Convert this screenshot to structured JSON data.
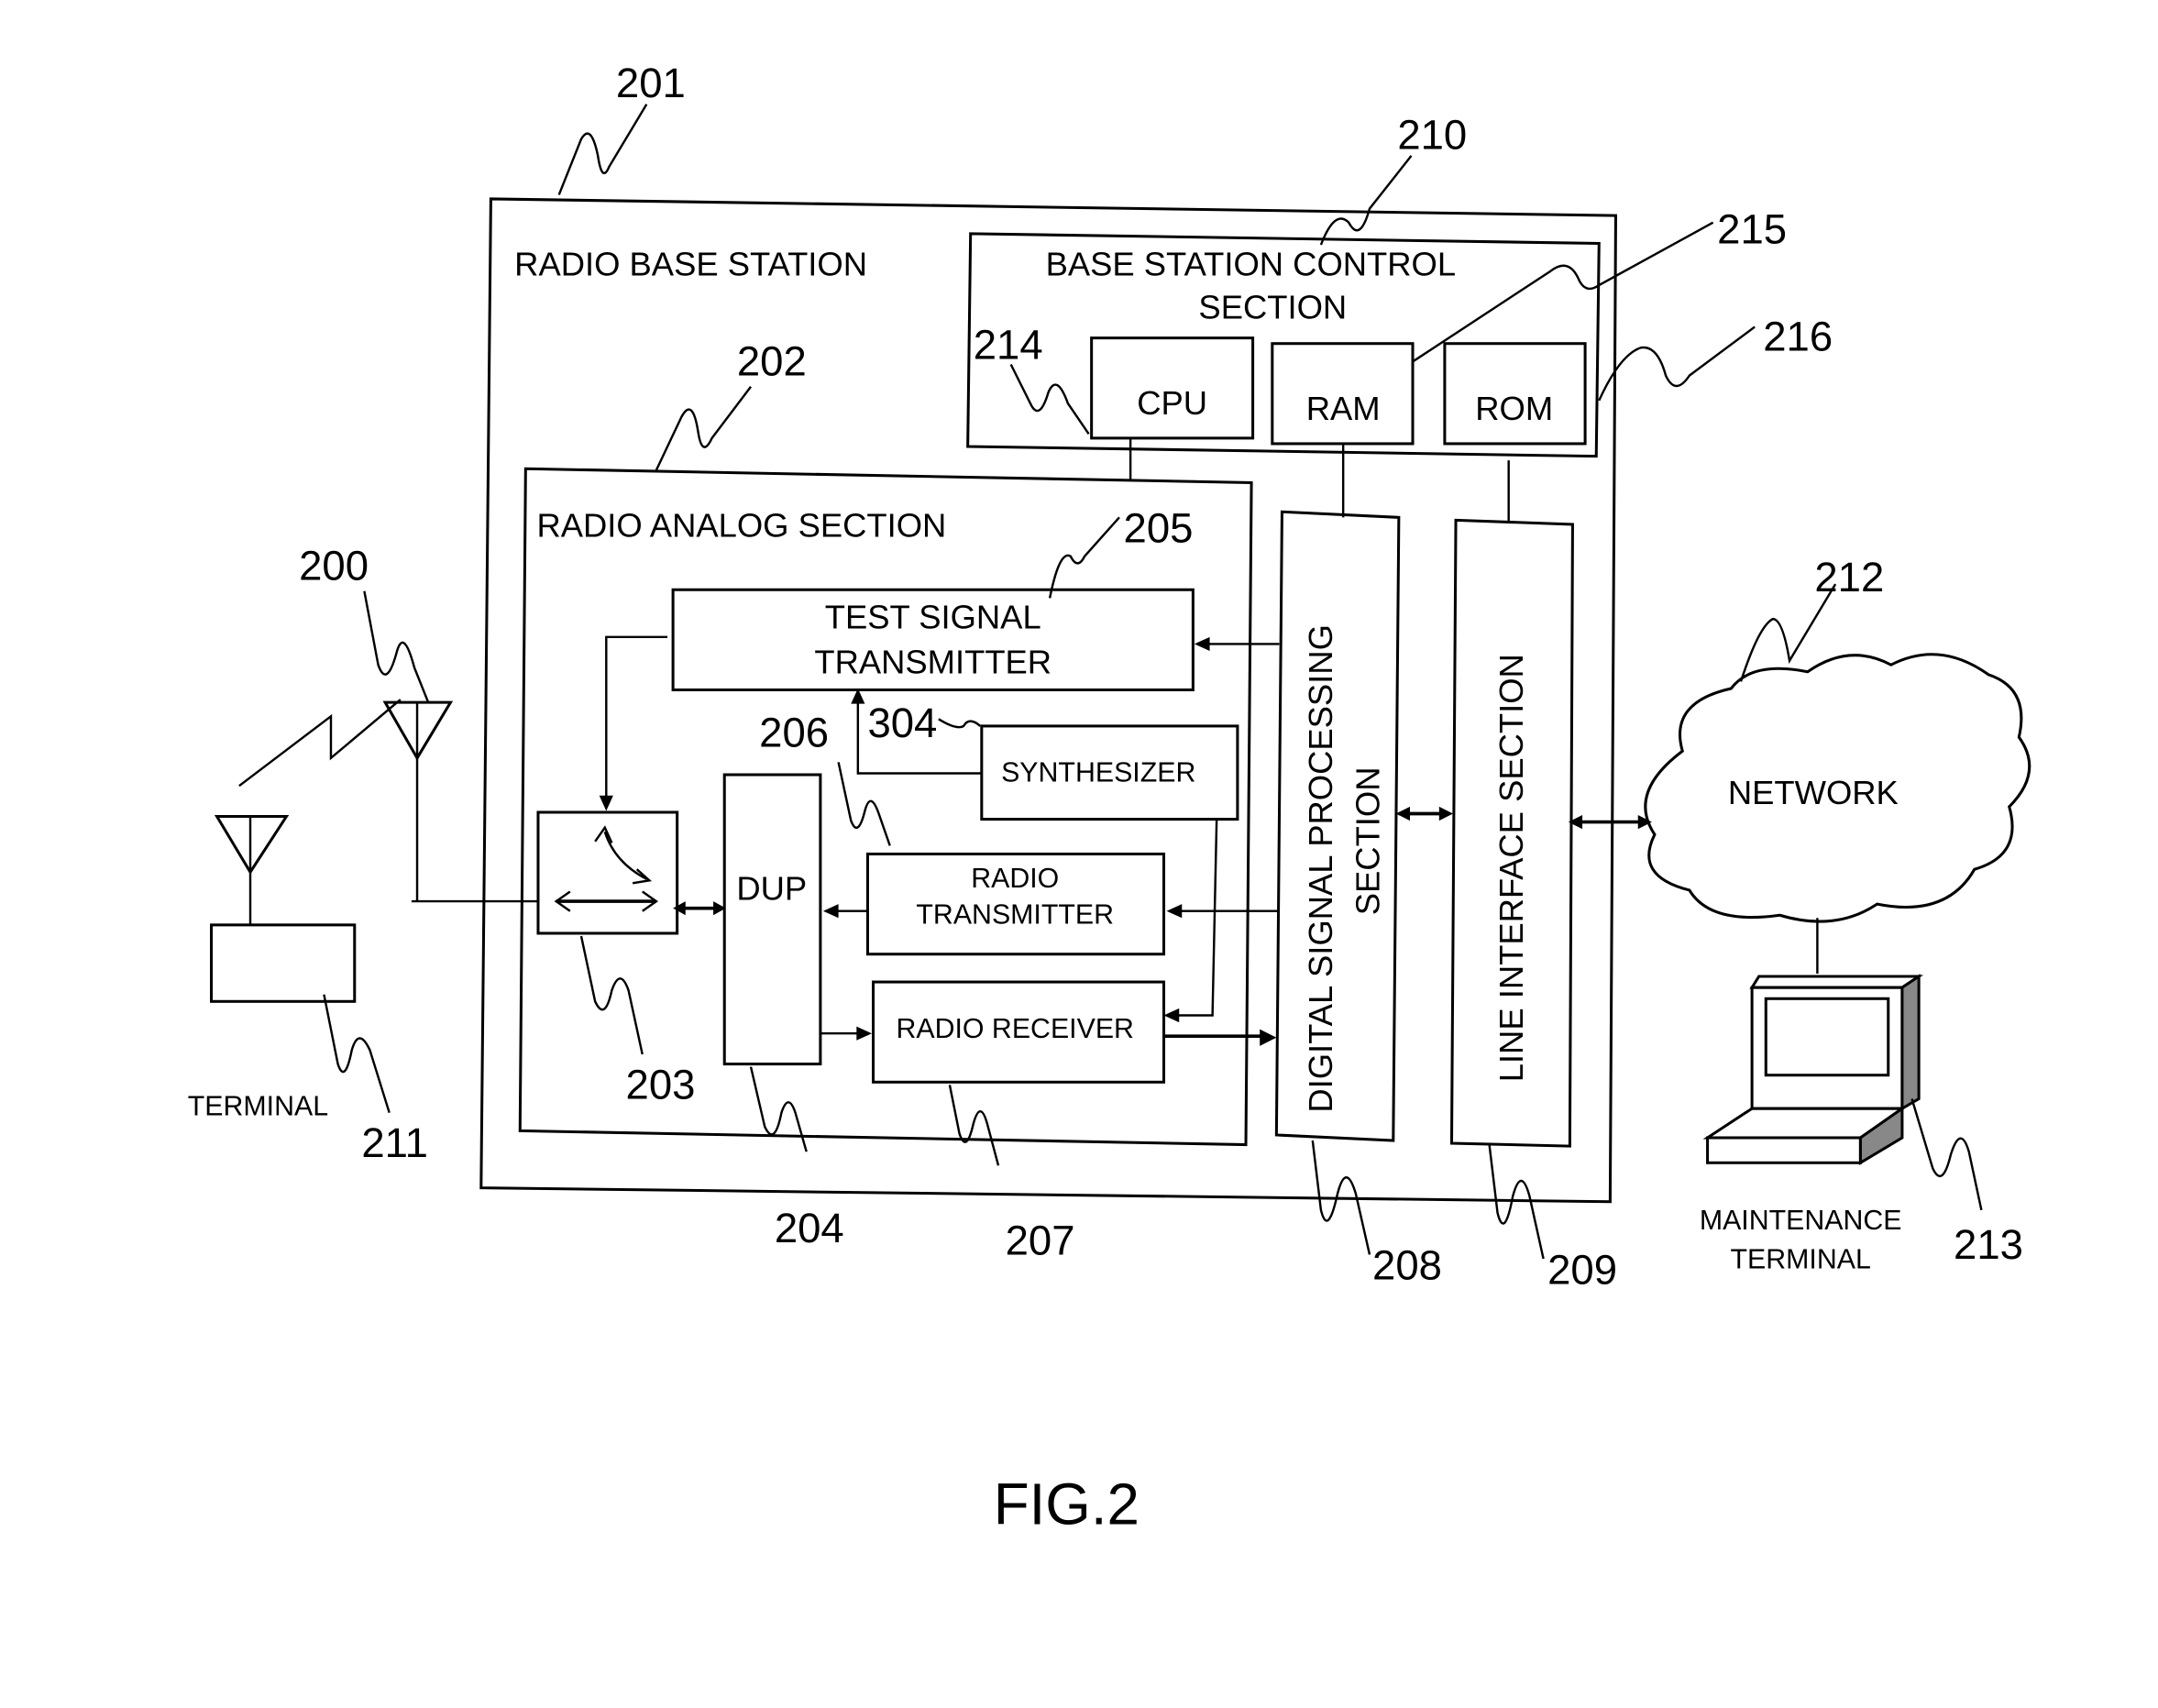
{
  "figure": {
    "caption": "FIG.2",
    "blocks": {
      "radio_base_station": {
        "label": "RADIO BASE STATION",
        "ref": "201"
      },
      "base_station_control": {
        "label_line1": "BASE STATION CONTROL",
        "label_line2": "SECTION",
        "ref": "210"
      },
      "cpu": {
        "label": "CPU",
        "ref": "214"
      },
      "ram": {
        "label": "RAM",
        "ref": "215"
      },
      "rom": {
        "label": "ROM",
        "ref": "216"
      },
      "radio_analog": {
        "label": "RADIO ANALOG SECTION",
        "ref": "202"
      },
      "test_signal_transmitter": {
        "label_line1": "TEST SIGNAL",
        "label_line2": "TRANSMITTER",
        "ref": "205"
      },
      "synthesizer": {
        "label": "SYNTHESIZER",
        "ref": "304"
      },
      "dup": {
        "label": "DUP",
        "ref": "204"
      },
      "switch": {
        "ref": "203"
      },
      "radio_transmitter": {
        "label_line1": "RADIO",
        "label_line2": "TRANSMITTER",
        "ref": "206"
      },
      "radio_receiver": {
        "label": "RADIO RECEIVER",
        "ref": "207"
      },
      "dsp": {
        "label_line1": "DIGITAL SIGNAL PROCESSING",
        "label_line2": "SECTION",
        "ref": "208"
      },
      "line_interface": {
        "label": "LINE INTERFACE SECTION",
        "ref": "209"
      },
      "antenna": {
        "ref": "200"
      },
      "terminal": {
        "label": "TERMINAL",
        "ref": "211"
      },
      "network": {
        "label": "NETWORK",
        "ref": "212"
      },
      "maintenance_terminal": {
        "label_line1": "MAINTENANCE",
        "label_line2": "TERMINAL",
        "ref": "213"
      }
    }
  }
}
